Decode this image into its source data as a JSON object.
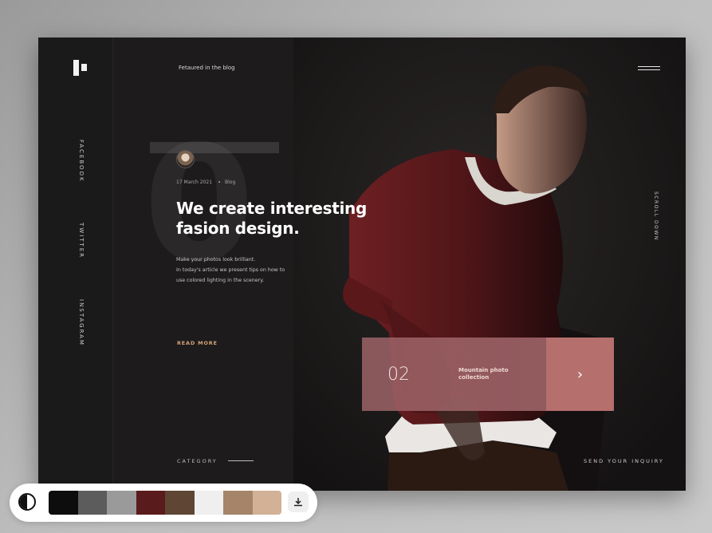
{
  "nav": {
    "featured_label": "Fetaured in the blog",
    "social": [
      "FACEBOOK",
      "TWITTER",
      "INSTAGRAM"
    ],
    "scroll_label": "SCROLL DOWN"
  },
  "hero": {
    "big_number": "0",
    "date": "17 March 2021",
    "tag": "Blog",
    "headline": "We create interesting fasion design.",
    "description_line1": "Make your photos look brilliant.",
    "description_line2": "In today's article we present tips on how to use colored lighting in the scenery.",
    "read_more": "READ MORE"
  },
  "card": {
    "number": "02",
    "title": "Mountain photo collection",
    "arrow": "›"
  },
  "footer": {
    "category": "CATEGORY",
    "inquiry": "SEND YOUR INQUIRY"
  },
  "palette": {
    "colors": [
      "#0d0d0d",
      "#5c5c5c",
      "#9a9a9a",
      "#5a1b1c",
      "#5e4534",
      "#efefef",
      "#a58469",
      "#d2b196"
    ]
  },
  "colors": {
    "accent": "#b56f6d",
    "read_more": "#d3a27a",
    "background": "#1d1b1b"
  },
  "icons": {
    "logo": "brand-logo",
    "menu": "hamburger-icon",
    "contrast": "contrast-icon",
    "download": "download-icon"
  }
}
